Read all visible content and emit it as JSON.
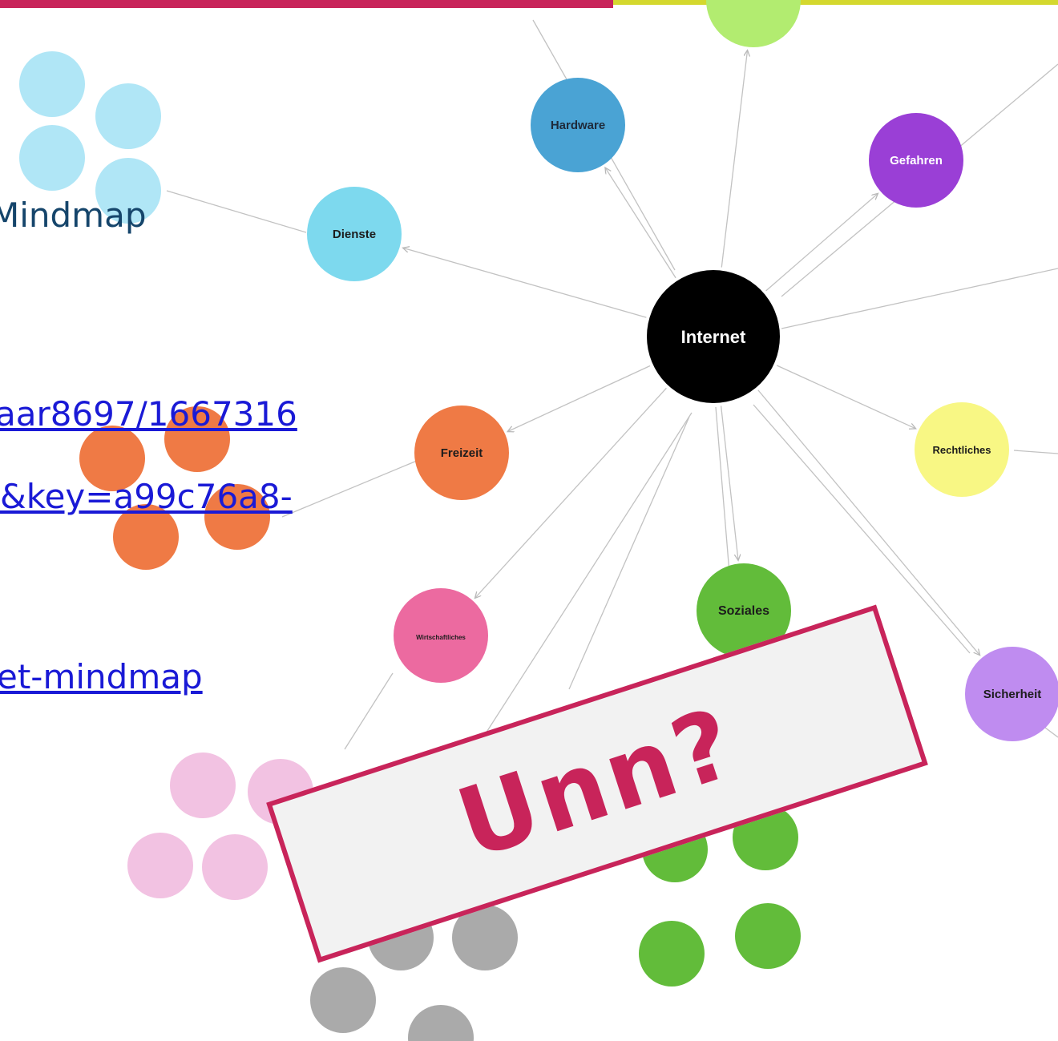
{
  "slide": {
    "title": "Mindmap",
    "links": [
      "aar8697/1667316",
      "&key=a99c76a8-",
      "et-mindmap"
    ]
  },
  "mindmap": {
    "center": {
      "label": "Internet",
      "color": "#000000"
    },
    "nodes": [
      {
        "id": "hardware",
        "label": "Hardware",
        "color": "#4aa3d4"
      },
      {
        "id": "gefahren",
        "label": "Gefahren",
        "color": "#9a3fd6"
      },
      {
        "id": "dienste",
        "label": "Dienste",
        "color": "#7dd9ee"
      },
      {
        "id": "freizeit",
        "label": "Freizeit",
        "color": "#ef7a45"
      },
      {
        "id": "rechtliches",
        "label": "Rechtliches",
        "color": "#f8f784"
      },
      {
        "id": "wirtschaftliches",
        "label": "Wirtschaftliches",
        "color": "#ec6aa0"
      },
      {
        "id": "soziales",
        "label": "Soziales",
        "color": "#62bc3a"
      },
      {
        "id": "sicherheit",
        "label": "Sicherheit",
        "color": "#bf8cf0"
      },
      {
        "id": "top",
        "label": "",
        "color": "#b2ec70"
      }
    ],
    "clusters": [
      {
        "id": "dienste",
        "color": "#b0e6f6"
      },
      {
        "id": "freizeit",
        "color": "#ef7a45"
      },
      {
        "id": "wirtschaftliches",
        "color": "#f2c2e2"
      },
      {
        "id": "soziales",
        "color": "#62bc3a"
      },
      {
        "id": "grau",
        "color": "#aaaaaa"
      }
    ]
  },
  "stamp": {
    "text": "Unn?"
  },
  "colors": {
    "accent": "#c8245a",
    "accent2": "#d4d82e",
    "link": "#1a1ad6",
    "title": "#15456b"
  }
}
